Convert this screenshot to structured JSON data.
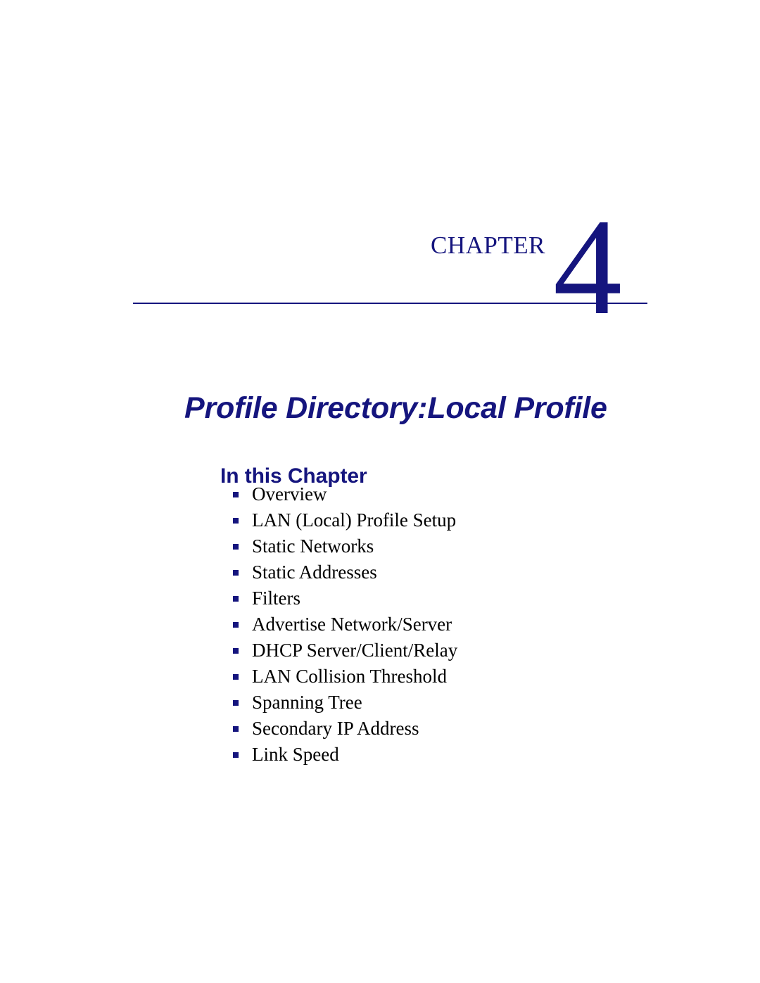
{
  "page": {
    "background_color": "#ffffff",
    "accent_color": "#15157e",
    "body_text_color": "#000000"
  },
  "chapter_head": {
    "word": "Chapter",
    "number": "4"
  },
  "chapter_title": "Profile Directory:Local Profile",
  "section": {
    "heading": "In this Chapter",
    "items": [
      {
        "label": "Overview"
      },
      {
        "label": "LAN (Local) Profile Setup"
      },
      {
        "label": "Static Networks"
      },
      {
        "label": "Static Addresses"
      },
      {
        "label": "Filters"
      },
      {
        "label": "Advertise Network/Server"
      },
      {
        "label": "DHCP Server/Client/Relay"
      },
      {
        "label": "LAN Collision Threshold"
      },
      {
        "label": "Spanning Tree"
      },
      {
        "label": "Secondary IP Address"
      },
      {
        "label": "Link Speed"
      }
    ]
  }
}
